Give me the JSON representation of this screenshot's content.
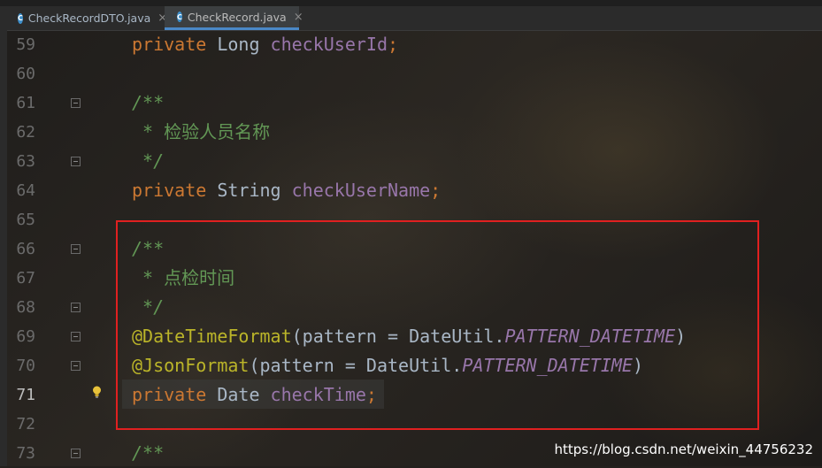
{
  "tabs": [
    {
      "label": "CheckRecordDTO.java",
      "icon": "java-class-icon",
      "active": false
    },
    {
      "label": "CheckRecord.java",
      "icon": "java-class-icon",
      "active": true
    }
  ],
  "lines": [
    {
      "num": "59",
      "tokens": [
        {
          "t": "private ",
          "c": "kw"
        },
        {
          "t": "Long ",
          "c": "plain"
        },
        {
          "t": "checkUserId",
          "c": "field"
        },
        {
          "t": ";",
          "c": "kw"
        }
      ]
    },
    {
      "num": "60",
      "tokens": []
    },
    {
      "num": "61",
      "tokens": [
        {
          "t": "/**",
          "c": "cm"
        }
      ]
    },
    {
      "num": "62",
      "tokens": [
        {
          "t": " * ",
          "c": "cm"
        },
        {
          "t": "检验人员名称",
          "c": "cmzh"
        }
      ]
    },
    {
      "num": "63",
      "tokens": [
        {
          "t": " */",
          "c": "cm"
        }
      ]
    },
    {
      "num": "64",
      "tokens": [
        {
          "t": "private ",
          "c": "kw"
        },
        {
          "t": "String ",
          "c": "plain"
        },
        {
          "t": "checkUserName",
          "c": "field"
        },
        {
          "t": ";",
          "c": "kw"
        }
      ]
    },
    {
      "num": "65",
      "tokens": []
    },
    {
      "num": "66",
      "tokens": [
        {
          "t": "/**",
          "c": "cm"
        }
      ]
    },
    {
      "num": "67",
      "tokens": [
        {
          "t": " * ",
          "c": "cm"
        },
        {
          "t": "点检时间",
          "c": "cmzh"
        }
      ]
    },
    {
      "num": "68",
      "tokens": [
        {
          "t": " */",
          "c": "cm"
        }
      ]
    },
    {
      "num": "69",
      "tokens": [
        {
          "t": "@DateTimeFormat",
          "c": "ann"
        },
        {
          "t": "(pattern = DateUtil.",
          "c": "plain"
        },
        {
          "t": "PATTERN_DATETIME",
          "c": "const"
        },
        {
          "t": ")",
          "c": "plain"
        }
      ]
    },
    {
      "num": "70",
      "tokens": [
        {
          "t": "@JsonFormat",
          "c": "ann"
        },
        {
          "t": "(pattern = DateUtil.",
          "c": "plain"
        },
        {
          "t": "PATTERN_DATETIME",
          "c": "const"
        },
        {
          "t": ")",
          "c": "plain"
        }
      ]
    },
    {
      "num": "71",
      "tokens": [
        {
          "t": "private ",
          "c": "kw"
        },
        {
          "t": "Date ",
          "c": "plain"
        },
        {
          "t": "checkTime",
          "c": "field"
        },
        {
          "t": ";",
          "c": "kw"
        }
      ]
    },
    {
      "num": "72",
      "tokens": []
    },
    {
      "num": "73",
      "tokens": [
        {
          "t": "/**",
          "c": "cm"
        }
      ]
    }
  ],
  "current_line": "71",
  "fold_markers": [
    "61",
    "63",
    "66",
    "68",
    "69",
    "70",
    "73"
  ],
  "watermark": "https://blog.csdn.net/weixin_44756232",
  "colors": {
    "keyword": "#cc7832",
    "field": "#9876aa",
    "comment": "#629755",
    "annotation": "#bbb529",
    "plain": "#a9b7c6",
    "highlight_box": "#e02020"
  }
}
